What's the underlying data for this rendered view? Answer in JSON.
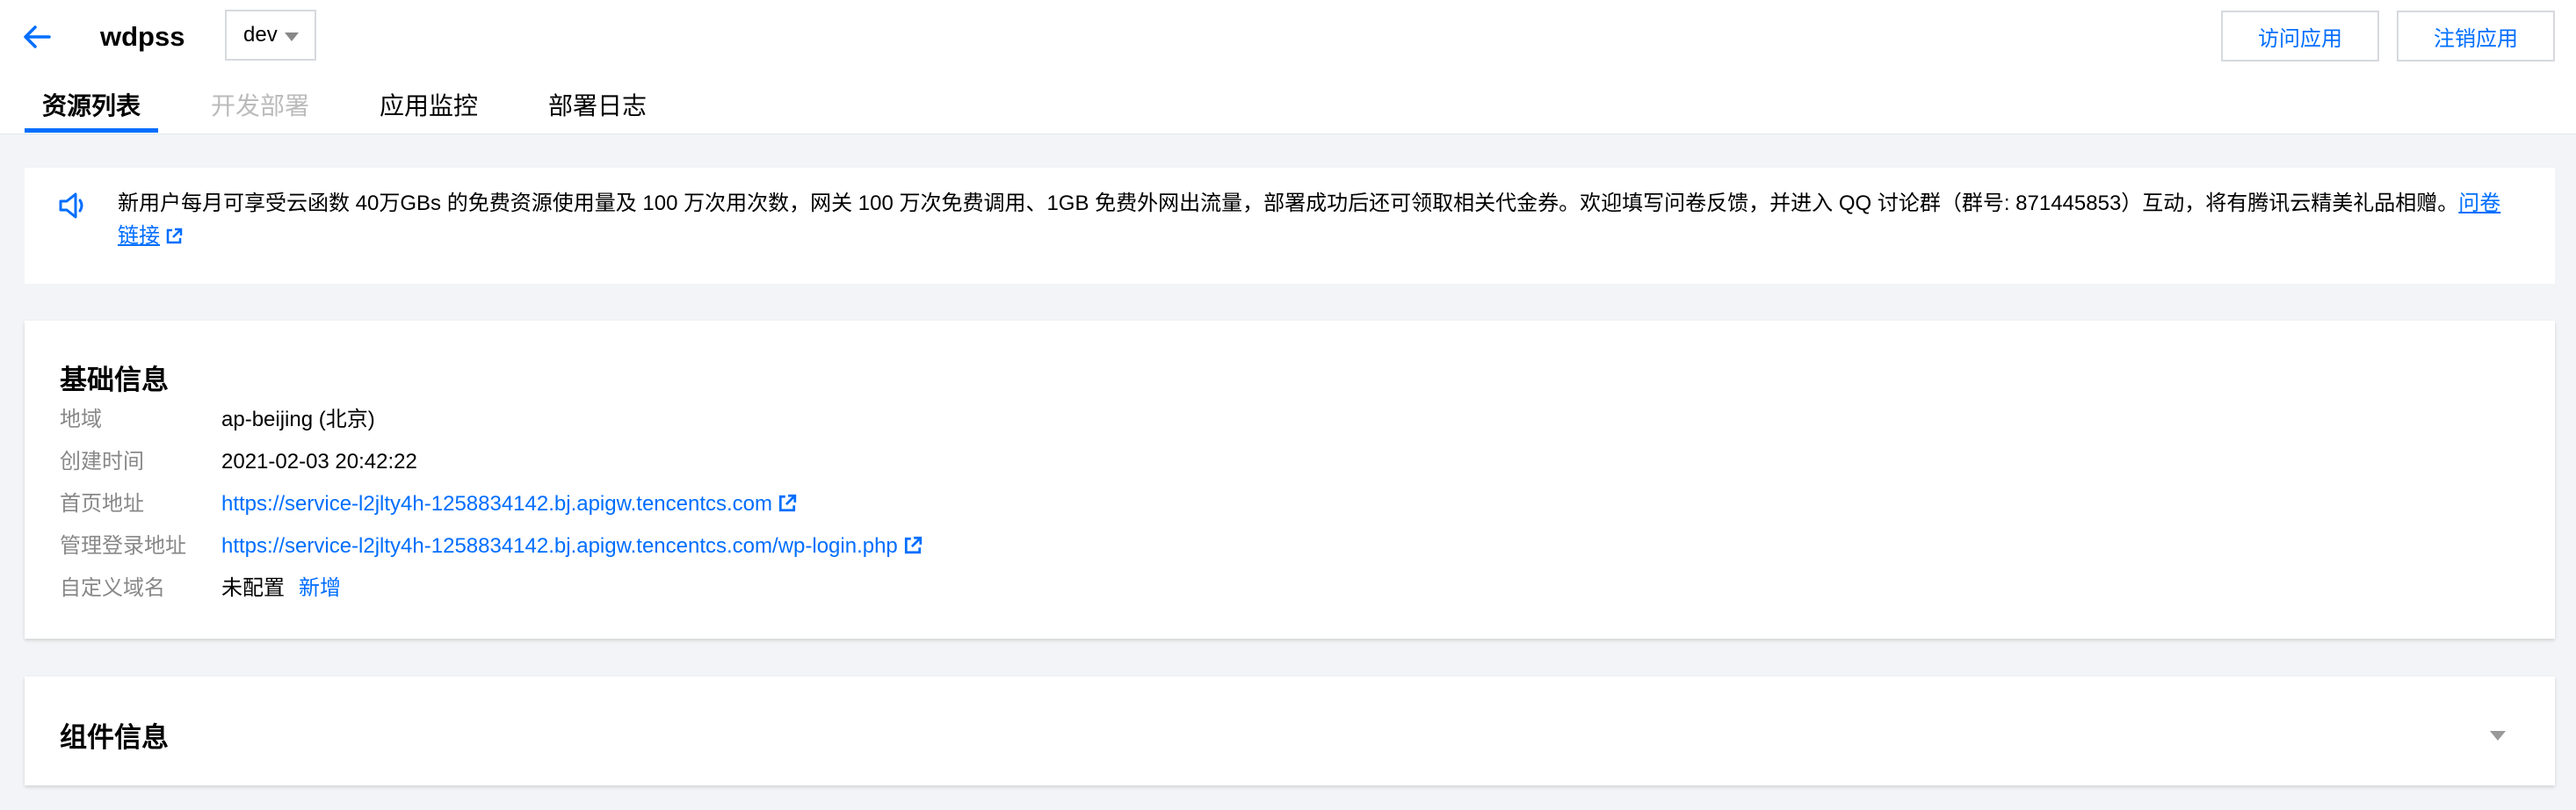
{
  "header": {
    "app_name": "wdpss",
    "env": "dev",
    "visit_button": "访问应用",
    "cancel_button": "注销应用"
  },
  "tabs": [
    {
      "label": "资源列表",
      "state": "active"
    },
    {
      "label": "开发部署",
      "state": "disabled"
    },
    {
      "label": "应用监控",
      "state": "normal"
    },
    {
      "label": "部署日志",
      "state": "normal"
    }
  ],
  "notice": {
    "text": "新用户每月可享受云函数 40万GBs 的免费资源使用量及 100 万次用次数，网关 100 万次免费调用、1GB 免费外网出流量，部署成功后还可领取相关代金券。欢迎填写问卷反馈，并进入 QQ 讨论群（群号: 871445853）互动，将有腾讯云精美礼品相赠。",
    "link_text": "问卷链接"
  },
  "basic_info": {
    "title": "基础信息",
    "region": {
      "label": "地域",
      "value": "ap-beijing (北京)"
    },
    "created": {
      "label": "创建时间",
      "value": "2021-02-03 20:42:22"
    },
    "homepage": {
      "label": "首页地址",
      "value": "https://service-l2jlty4h-1258834142.bj.apigw.tencentcs.com"
    },
    "admin_login": {
      "label": "管理登录地址",
      "value": "https://service-l2jlty4h-1258834142.bj.apigw.tencentcs.com/wp-login.php"
    },
    "custom_domain": {
      "label": "自定义域名",
      "value": "未配置",
      "action": "新增"
    }
  },
  "component_info": {
    "title": "组件信息"
  },
  "colors": {
    "accent": "#006eff",
    "label_gray": "#888888",
    "page_bg": "#f2f4f7"
  }
}
